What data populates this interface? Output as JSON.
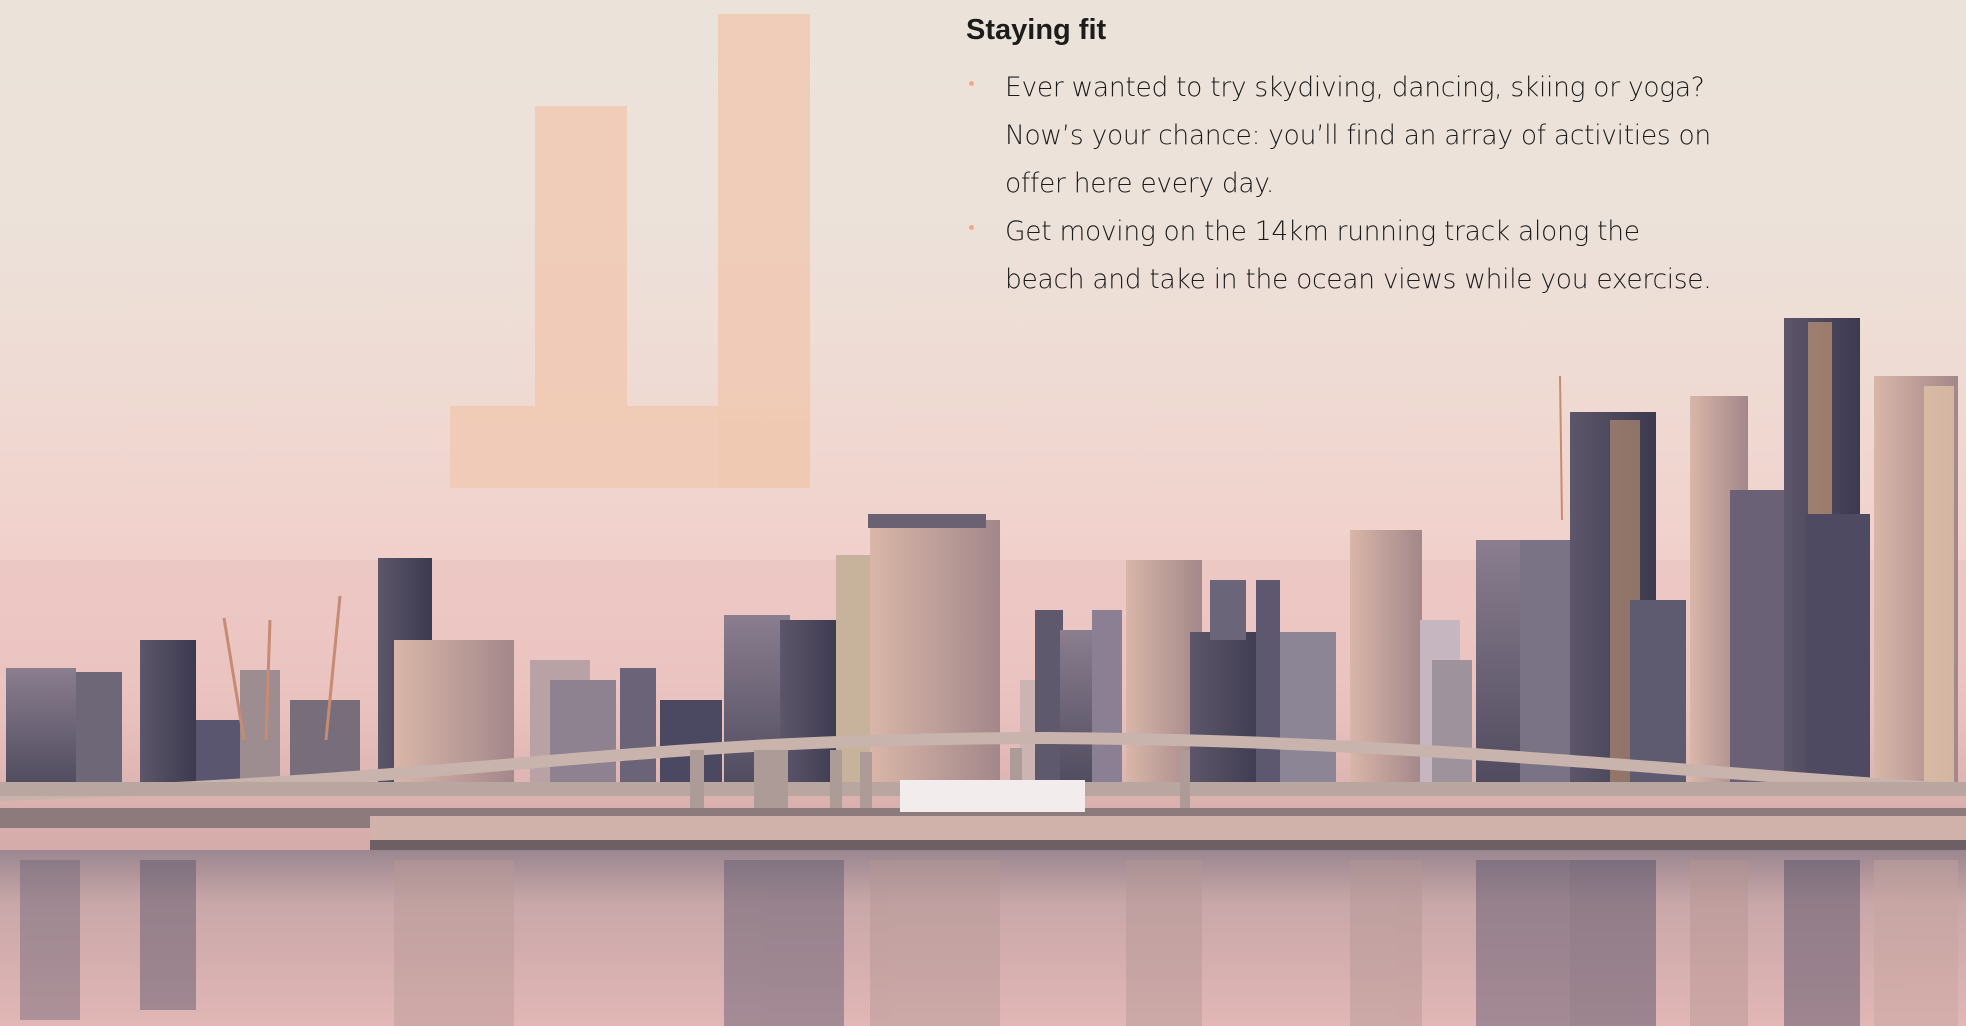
{
  "section": {
    "heading": "Staying fit",
    "bullets": [
      "Ever wanted to try skydiving, dancing, skiing or yoga? Now’s your chance: you’ll find an array of activities on offer here every day.",
      "Get moving on the 14km running track along the beach and take in the ocean views while you exercise."
    ]
  },
  "colors": {
    "bullet_dot": "#eeaa88",
    "deco_bar": "#f0c9b3"
  },
  "icons": {
    "bullet": "bullet-dot-icon"
  }
}
